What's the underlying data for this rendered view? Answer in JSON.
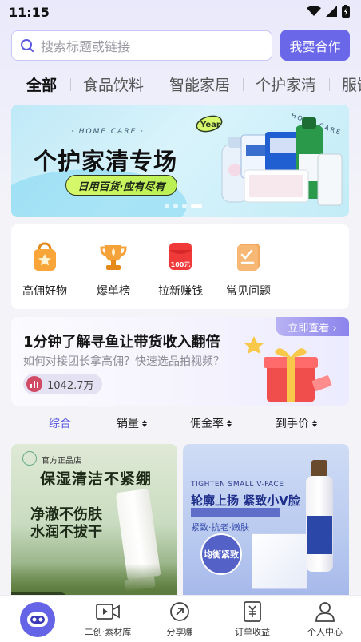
{
  "status_bar": {
    "time": "11:15"
  },
  "search": {
    "placeholder": "搜索标题或链接",
    "cta": "我要合作"
  },
  "categories": [
    "全部",
    "食品饮料",
    "智能家居",
    "个护家清",
    "服饰"
  ],
  "banner": {
    "kicker": "· HOME CARE ·",
    "title": "个护家清专场",
    "subtitle": "日用百货·应有尽有",
    "badge": "Year",
    "side_text": "HOME CARE",
    "dots": 4,
    "active_dot": 3
  },
  "quick_links": [
    {
      "label": "高佣好物",
      "icon": "shopping-bag-star-icon"
    },
    {
      "label": "爆单榜",
      "icon": "trophy-icon"
    },
    {
      "label": "拉新赚钱",
      "icon": "red-envelope-icon",
      "badge": "100元"
    },
    {
      "label": "常见问题",
      "icon": "checklist-icon"
    }
  ],
  "promo": {
    "headline": "1分钟了解寻鱼让带货收入翻倍",
    "subtitle": "如何对接团长拿高佣？快速选品拍视频？",
    "views": "1042.7万",
    "action": "立即查看 ›"
  },
  "sort": [
    "综合",
    "销量",
    "佣金率",
    "到手价"
  ],
  "products": [
    {
      "store": "官方正品店",
      "headline": "保湿清洁不紧绷",
      "line1": "净澈不伤肤",
      "line2": "水润不拔干",
      "price_partial": "30"
    },
    {
      "english": "TIGHTEN SMALL V-FACE",
      "headline": "轮廓上扬 紧致小V脸",
      "tags": "紧致·抗老·嫩肤",
      "badge": "均衡紧致"
    }
  ],
  "bottom_nav": [
    {
      "label": "",
      "icon": "home-robot-icon"
    },
    {
      "label": "二创·素材库",
      "icon": "video-icon"
    },
    {
      "label": "分享赚",
      "icon": "share-arrow-icon"
    },
    {
      "label": "订单收益",
      "icon": "yen-receipt-icon"
    },
    {
      "label": "个人中心",
      "icon": "person-icon"
    }
  ],
  "colors": {
    "accent": "#6a68e9",
    "active_sort": "#5b58e0"
  }
}
